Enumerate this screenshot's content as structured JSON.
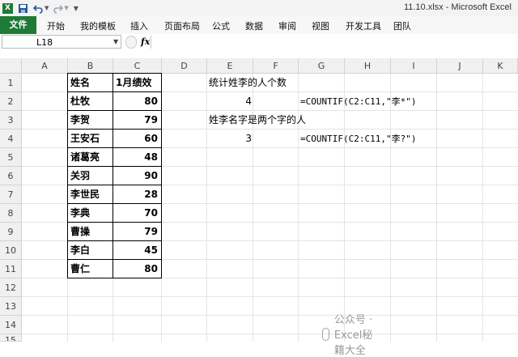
{
  "title_bar": {
    "title": "11.10.xlsx - Microsoft Excel",
    "excel_icon": "X"
  },
  "ribbon": {
    "tabs": [
      "文件",
      "开始",
      "我的模板",
      "插入",
      "页面布局",
      "公式",
      "数据",
      "审阅",
      "视图",
      "开发工具",
      "团队"
    ]
  },
  "formula_bar": {
    "name_box": "L18",
    "fx_label": "fx",
    "formula": ""
  },
  "columns": [
    "A",
    "B",
    "C",
    "D",
    "E",
    "F",
    "G",
    "H",
    "I",
    "J",
    "K"
  ],
  "rows": [
    "1",
    "2",
    "3",
    "4",
    "5",
    "6",
    "7",
    "8",
    "9",
    "10",
    "11",
    "12",
    "13",
    "14",
    "15"
  ],
  "table": {
    "header": [
      "姓名",
      "1月绩效"
    ],
    "rows": [
      [
        "杜牧",
        "80"
      ],
      [
        "李贺",
        "79"
      ],
      [
        "王安石",
        "60"
      ],
      [
        "诸葛亮",
        "48"
      ],
      [
        "关羽",
        "90"
      ],
      [
        "李世民",
        "28"
      ],
      [
        "李典",
        "70"
      ],
      [
        "曹操",
        "79"
      ],
      [
        "李白",
        "45"
      ],
      [
        "曹仁",
        "80"
      ]
    ]
  },
  "notes": {
    "e1": "统计姓李的人个数",
    "e2": "4",
    "g2": "=COUNTIF(C2:C11,\"李*\")",
    "e3": "姓李名字是两个字的人",
    "e4": "3",
    "g4": "=COUNTIF(C2:C11,\"李?\")"
  },
  "watermark": "公众号 · Excel秘籍大全"
}
